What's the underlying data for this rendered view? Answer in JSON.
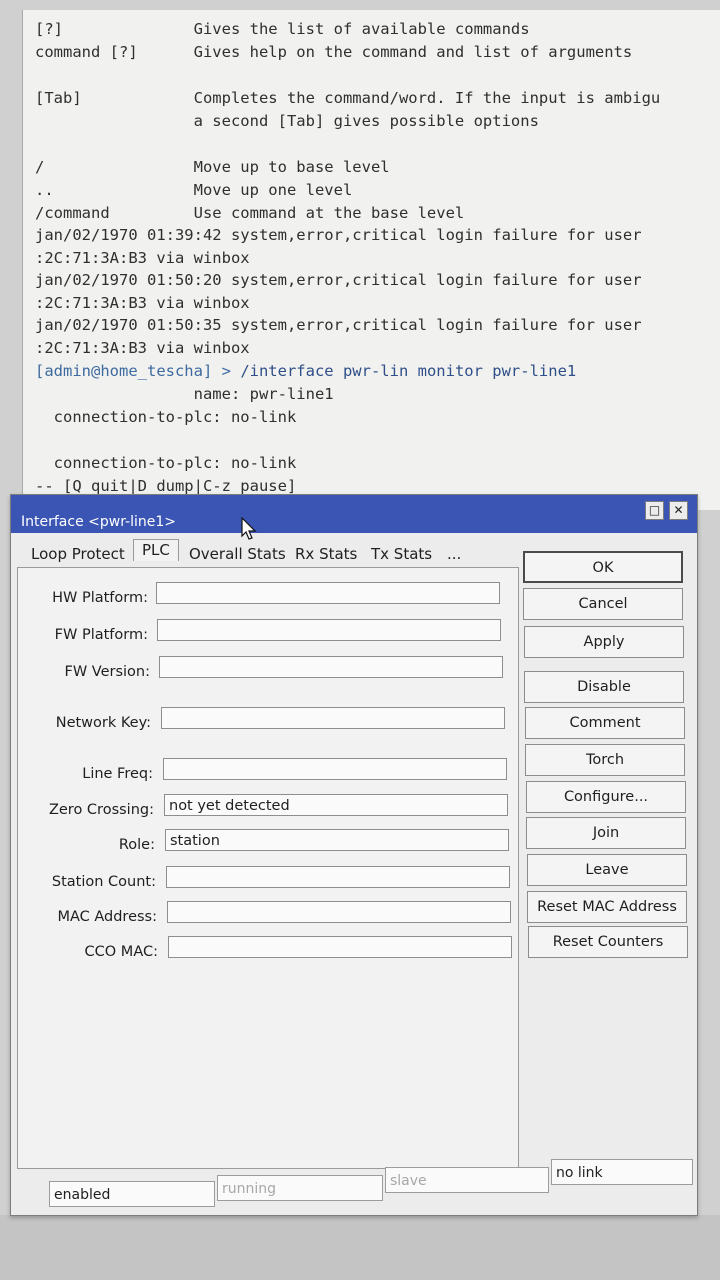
{
  "terminal": {
    "lines": [
      "[?]              Gives the list of available commands",
      "command [?]      Gives help on the command and list of arguments",
      "",
      "[Tab]            Completes the command/word. If the input is ambigu",
      "                 a second [Tab] gives possible options",
      "",
      "/                Move up to base level",
      "..               Move up one level",
      "/command         Use command at the base level",
      "jan/02/1970 01:39:42 system,error,critical login failure for user",
      ":2C:71:3A:B3 via winbox",
      "jan/02/1970 01:50:20 system,error,critical login failure for user",
      ":2C:71:3A:B3 via winbox",
      "jan/02/1970 01:50:35 system,error,critical login failure for user",
      ":2C:71:3A:B3 via winbox"
    ],
    "prompt": "[admin@home_tescha] > ",
    "command": "/interface pwr-lin monitor pwr-line1",
    "output": [
      "                 name: pwr-line1",
      "  connection-to-plc: no-link",
      "",
      "  connection-to-plc: no-link",
      "-- [Q quit|D dump|C-z pause]"
    ]
  },
  "dialog": {
    "title": "Interface <pwr-line1>",
    "titlebar_buttons": {
      "maximize": "□",
      "close": "✕"
    },
    "tabs": [
      "Loop Protect",
      "PLC",
      "Overall Stats",
      "Rx Stats",
      "Tx Stats",
      "..."
    ],
    "fields": [
      {
        "label": "HW Platform:",
        "value": ""
      },
      {
        "label": "FW Platform:",
        "value": ""
      },
      {
        "label": "FW Version:",
        "value": ""
      },
      {
        "label": "Network Key:",
        "value": ""
      },
      {
        "label": "Line Freq:",
        "value": ""
      },
      {
        "label": "Zero Crossing:",
        "value": "not yet detected"
      },
      {
        "label": "Role:",
        "value": "station"
      },
      {
        "label": "Station Count:",
        "value": ""
      },
      {
        "label": "MAC Address:",
        "value": ""
      },
      {
        "label": "CCO MAC:",
        "value": ""
      }
    ],
    "buttons": [
      "OK",
      "Cancel",
      "Apply",
      "Disable",
      "Comment",
      "Torch",
      "Configure...",
      "Join",
      "Leave",
      "Reset MAC Address",
      "Reset Counters"
    ],
    "status": [
      "enabled",
      "running",
      "slave",
      "no link"
    ]
  },
  "colors": {
    "titlebar": "#3a55b4",
    "dialog_bg": "#ececec",
    "terminal_bg": "#f1f1ef",
    "prompt": "#3d6aa0"
  }
}
